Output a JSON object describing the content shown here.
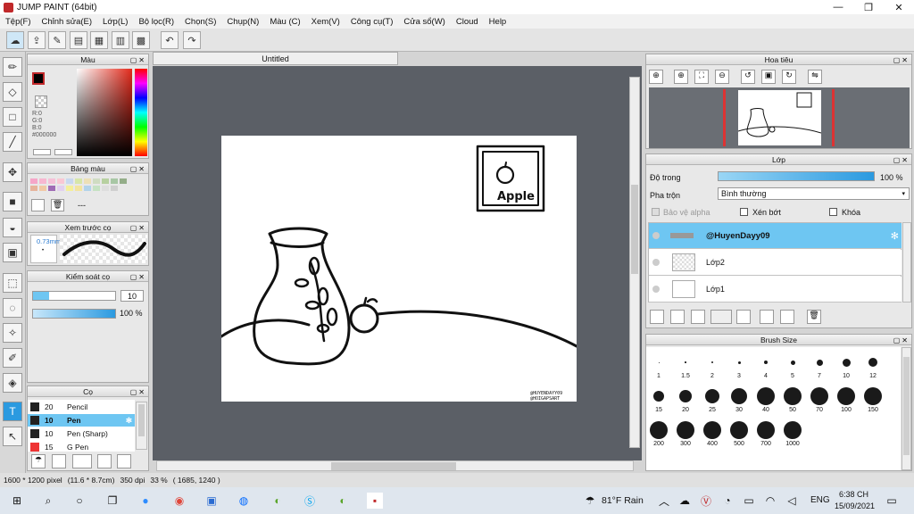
{
  "title": "JUMP PAINT (64bit)",
  "window_buttons": [
    "—",
    "❐",
    "✕"
  ],
  "menu": [
    "Tệp(F)",
    "Chỉnh sửa(E)",
    "Lớp(L)",
    "Bộ lọc(R)",
    "Chọn(S)",
    "Chụp(N)",
    "Màu (C)",
    "Xem(V)",
    "Công cụ(T)",
    "Cửa sổ(W)",
    "Cloud",
    "Help"
  ],
  "document_tab": "Untitled",
  "color_panel": {
    "title": "Màu",
    "r": "R:0",
    "g": "G:0",
    "b": "B:0",
    "hex": "#000000"
  },
  "swatch_panel": {
    "title": "Bảng màu",
    "dash": "---"
  },
  "brush_preview_panel": {
    "title": "Xem trước cọ",
    "size": "0.73mm"
  },
  "control_panel": {
    "title": "Kiểm soát cọ",
    "size_value": "10",
    "opacity_value": "100 %"
  },
  "brush_panel": {
    "title": "Cọ",
    "items": [
      {
        "size": "20",
        "name": "Pencil"
      },
      {
        "size": "10",
        "name": "Pen"
      },
      {
        "size": "10",
        "name": "Pen (Sharp)"
      },
      {
        "size": "15",
        "name": "G Pen"
      }
    ]
  },
  "navigator_panel": {
    "title": "Hoa tiêu"
  },
  "layer_panel": {
    "title": "Lớp",
    "opacity_label": "Độ trong",
    "opacity_value": "100 %",
    "blend_label": "Pha trộn",
    "blend_value": "Bình thường",
    "protect_alpha": "Bảo vệ alpha",
    "clipping": "Xén bớt",
    "lock": "Khóa",
    "layers": [
      "@HuyenDayy09",
      "Lớp2",
      "Lớp1"
    ]
  },
  "brush_size_panel": {
    "title": "Brush Size",
    "sizes": [
      "1",
      "1.5",
      "2",
      "3",
      "4",
      "5",
      "7",
      "10",
      "12",
      "15",
      "20",
      "25",
      "30",
      "40",
      "50",
      "70",
      "100",
      "150",
      "200",
      "300",
      "400",
      "500",
      "700",
      "1000"
    ]
  },
  "artwork": {
    "frame_text": "Apple",
    "signature_line1": "@HUYENDAYY09",
    "signature_line2": "@HOIGAPSART"
  },
  "status": {
    "size": "1600 * 1200 pixel",
    "cm": "(11.6 * 8.7cm)",
    "dpi": "350 dpi",
    "zoom": "33 %",
    "coords": "( 1685, 1240 )"
  },
  "taskbar": {
    "weather": "81°F  Rain",
    "lang": "ENG",
    "time": "6:38 CH",
    "date": "15/09/2021"
  },
  "colors": {
    "accent": "#6ec6f2",
    "canvas_bg": "#5b5f66",
    "title_red": "#c0282a"
  }
}
